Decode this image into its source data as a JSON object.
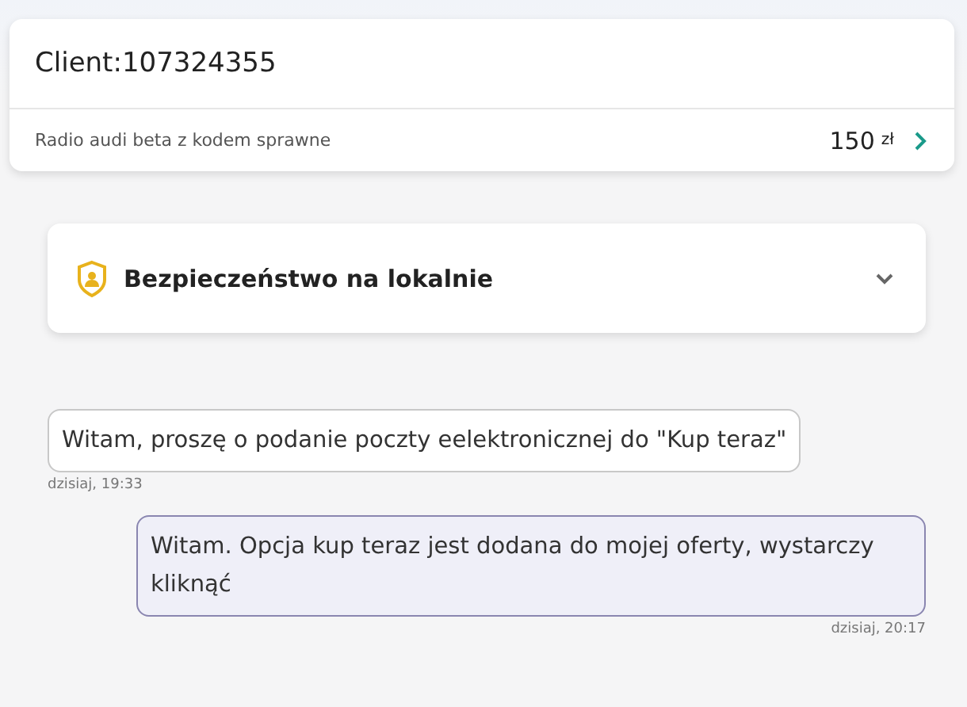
{
  "header": {
    "title": "Client:107324355",
    "item": "Radio audi beta z kodem sprawne",
    "price": "150",
    "currency": "zł"
  },
  "section": {
    "title": "Bezpieczeństwo na lokalnie",
    "expanded": false
  },
  "messages": [
    {
      "kind": "received",
      "text": "Witam, proszę o podanie poczty eelektronicznej do \"Kup teraz\"",
      "time": "dzisiaj, 19:33"
    },
    {
      "kind": "sent",
      "text": "Witam. Opcja kup teraz jest dodana do mojej oferty, wystarczy kliknąć",
      "time": "dzisiaj, 20:17"
    }
  ]
}
